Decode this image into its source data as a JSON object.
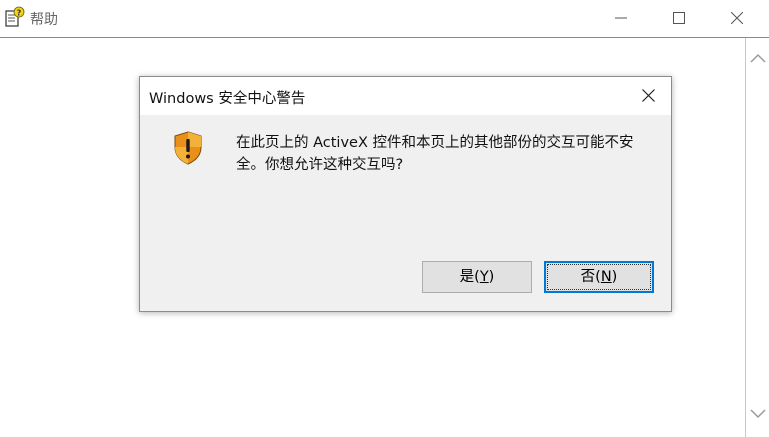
{
  "window": {
    "title": "帮助",
    "icon": "help-document-icon",
    "controls": [
      "minimize-icon",
      "maximize-icon",
      "close-icon"
    ]
  },
  "dialog": {
    "title": "Windows 安全中心警告",
    "icon": "warning-shield-icon",
    "message": "在此页上的 ActiveX 控件和本页上的其他部份的交互可能不安全。你想允许这种交互吗?",
    "yes_button": {
      "label": "是(",
      "mnemonic": "Y",
      "suffix": ")"
    },
    "no_button": {
      "label": "否(",
      "mnemonic": "N",
      "suffix": ")"
    }
  },
  "colors": {
    "dialog_bg": "#f0f0f0",
    "focus_border": "#0078d7",
    "shield_orange": "#e8901a",
    "shield_blue": "#2b5fb3"
  }
}
